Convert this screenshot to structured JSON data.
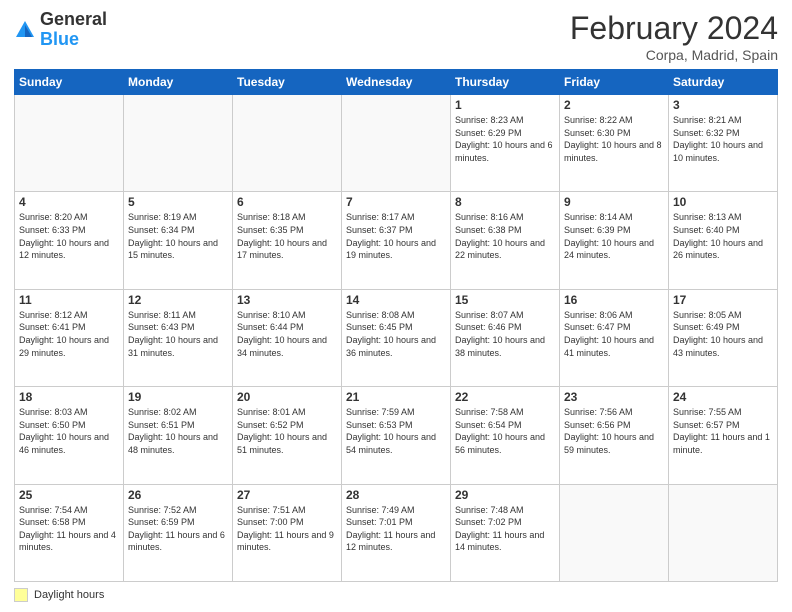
{
  "header": {
    "logo": {
      "general": "General",
      "blue": "Blue"
    },
    "title": "February 2024",
    "location": "Corpa, Madrid, Spain"
  },
  "calendar": {
    "days_of_week": [
      "Sunday",
      "Monday",
      "Tuesday",
      "Wednesday",
      "Thursday",
      "Friday",
      "Saturday"
    ],
    "weeks": [
      [
        {
          "day": "",
          "info": ""
        },
        {
          "day": "",
          "info": ""
        },
        {
          "day": "",
          "info": ""
        },
        {
          "day": "",
          "info": ""
        },
        {
          "day": "1",
          "info": "Sunrise: 8:23 AM\nSunset: 6:29 PM\nDaylight: 10 hours and 6 minutes."
        },
        {
          "day": "2",
          "info": "Sunrise: 8:22 AM\nSunset: 6:30 PM\nDaylight: 10 hours and 8 minutes."
        },
        {
          "day": "3",
          "info": "Sunrise: 8:21 AM\nSunset: 6:32 PM\nDaylight: 10 hours and 10 minutes."
        }
      ],
      [
        {
          "day": "4",
          "info": "Sunrise: 8:20 AM\nSunset: 6:33 PM\nDaylight: 10 hours and 12 minutes."
        },
        {
          "day": "5",
          "info": "Sunrise: 8:19 AM\nSunset: 6:34 PM\nDaylight: 10 hours and 15 minutes."
        },
        {
          "day": "6",
          "info": "Sunrise: 8:18 AM\nSunset: 6:35 PM\nDaylight: 10 hours and 17 minutes."
        },
        {
          "day": "7",
          "info": "Sunrise: 8:17 AM\nSunset: 6:37 PM\nDaylight: 10 hours and 19 minutes."
        },
        {
          "day": "8",
          "info": "Sunrise: 8:16 AM\nSunset: 6:38 PM\nDaylight: 10 hours and 22 minutes."
        },
        {
          "day": "9",
          "info": "Sunrise: 8:14 AM\nSunset: 6:39 PM\nDaylight: 10 hours and 24 minutes."
        },
        {
          "day": "10",
          "info": "Sunrise: 8:13 AM\nSunset: 6:40 PM\nDaylight: 10 hours and 26 minutes."
        }
      ],
      [
        {
          "day": "11",
          "info": "Sunrise: 8:12 AM\nSunset: 6:41 PM\nDaylight: 10 hours and 29 minutes."
        },
        {
          "day": "12",
          "info": "Sunrise: 8:11 AM\nSunset: 6:43 PM\nDaylight: 10 hours and 31 minutes."
        },
        {
          "day": "13",
          "info": "Sunrise: 8:10 AM\nSunset: 6:44 PM\nDaylight: 10 hours and 34 minutes."
        },
        {
          "day": "14",
          "info": "Sunrise: 8:08 AM\nSunset: 6:45 PM\nDaylight: 10 hours and 36 minutes."
        },
        {
          "day": "15",
          "info": "Sunrise: 8:07 AM\nSunset: 6:46 PM\nDaylight: 10 hours and 38 minutes."
        },
        {
          "day": "16",
          "info": "Sunrise: 8:06 AM\nSunset: 6:47 PM\nDaylight: 10 hours and 41 minutes."
        },
        {
          "day": "17",
          "info": "Sunrise: 8:05 AM\nSunset: 6:49 PM\nDaylight: 10 hours and 43 minutes."
        }
      ],
      [
        {
          "day": "18",
          "info": "Sunrise: 8:03 AM\nSunset: 6:50 PM\nDaylight: 10 hours and 46 minutes."
        },
        {
          "day": "19",
          "info": "Sunrise: 8:02 AM\nSunset: 6:51 PM\nDaylight: 10 hours and 48 minutes."
        },
        {
          "day": "20",
          "info": "Sunrise: 8:01 AM\nSunset: 6:52 PM\nDaylight: 10 hours and 51 minutes."
        },
        {
          "day": "21",
          "info": "Sunrise: 7:59 AM\nSunset: 6:53 PM\nDaylight: 10 hours and 54 minutes."
        },
        {
          "day": "22",
          "info": "Sunrise: 7:58 AM\nSunset: 6:54 PM\nDaylight: 10 hours and 56 minutes."
        },
        {
          "day": "23",
          "info": "Sunrise: 7:56 AM\nSunset: 6:56 PM\nDaylight: 10 hours and 59 minutes."
        },
        {
          "day": "24",
          "info": "Sunrise: 7:55 AM\nSunset: 6:57 PM\nDaylight: 11 hours and 1 minute."
        }
      ],
      [
        {
          "day": "25",
          "info": "Sunrise: 7:54 AM\nSunset: 6:58 PM\nDaylight: 11 hours and 4 minutes."
        },
        {
          "day": "26",
          "info": "Sunrise: 7:52 AM\nSunset: 6:59 PM\nDaylight: 11 hours and 6 minutes."
        },
        {
          "day": "27",
          "info": "Sunrise: 7:51 AM\nSunset: 7:00 PM\nDaylight: 11 hours and 9 minutes."
        },
        {
          "day": "28",
          "info": "Sunrise: 7:49 AM\nSunset: 7:01 PM\nDaylight: 11 hours and 12 minutes."
        },
        {
          "day": "29",
          "info": "Sunrise: 7:48 AM\nSunset: 7:02 PM\nDaylight: 11 hours and 14 minutes."
        },
        {
          "day": "",
          "info": ""
        },
        {
          "day": "",
          "info": ""
        }
      ]
    ]
  },
  "legend": {
    "label": "Daylight hours"
  }
}
